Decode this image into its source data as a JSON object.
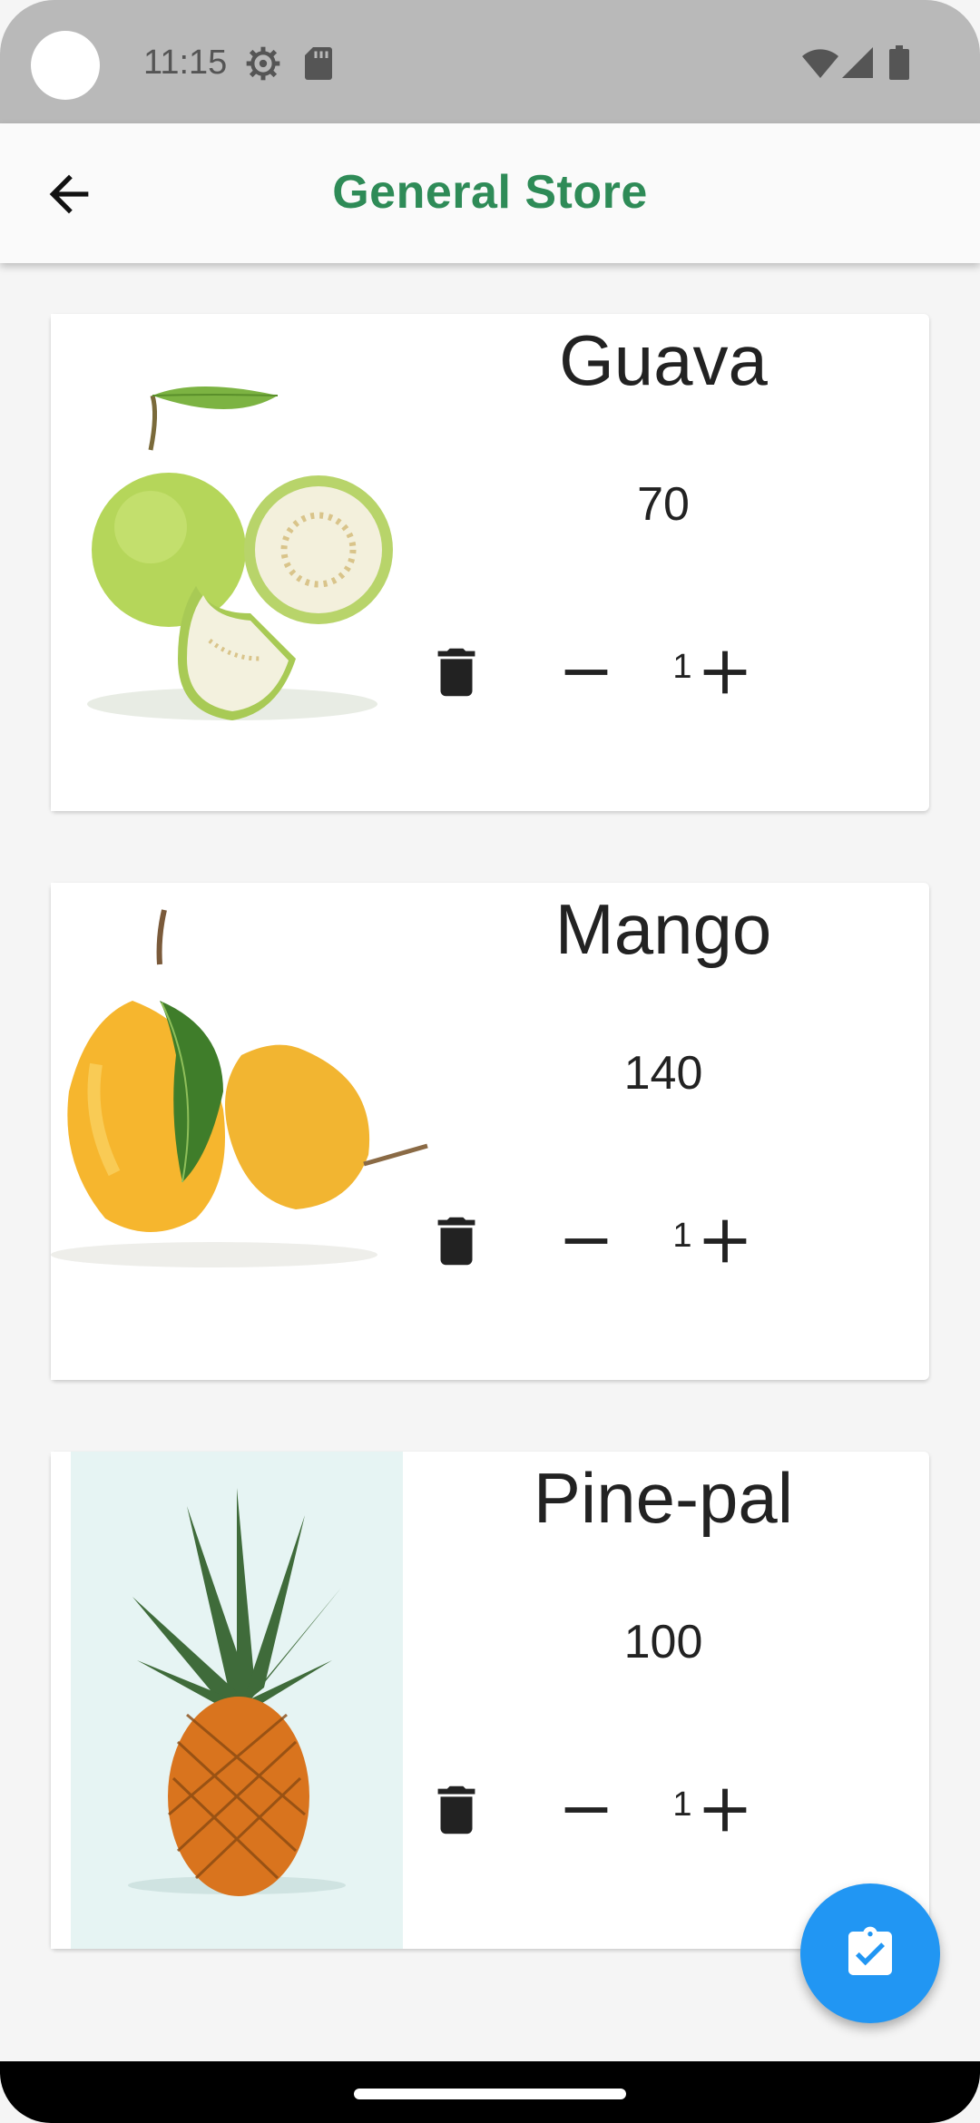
{
  "status": {
    "time": "11:15",
    "icons": [
      "settings-gear-icon",
      "sd-card-icon",
      "wifi-icon",
      "cell-signal-icon",
      "battery-icon"
    ]
  },
  "appbar": {
    "title": "General Store",
    "back_icon": "arrow-back-icon"
  },
  "products": [
    {
      "name": "Guava",
      "price": "70",
      "quantity": "1"
    },
    {
      "name": "Mango",
      "price": "140",
      "quantity": "1"
    },
    {
      "name": "Pine-pal",
      "price": "100",
      "quantity": "1"
    }
  ],
  "fab": {
    "icon": "clipboard-check-icon"
  },
  "colors": {
    "accent": "#2e8b57",
    "fab": "#2196f3",
    "statusbar": "#b9b9b9"
  }
}
